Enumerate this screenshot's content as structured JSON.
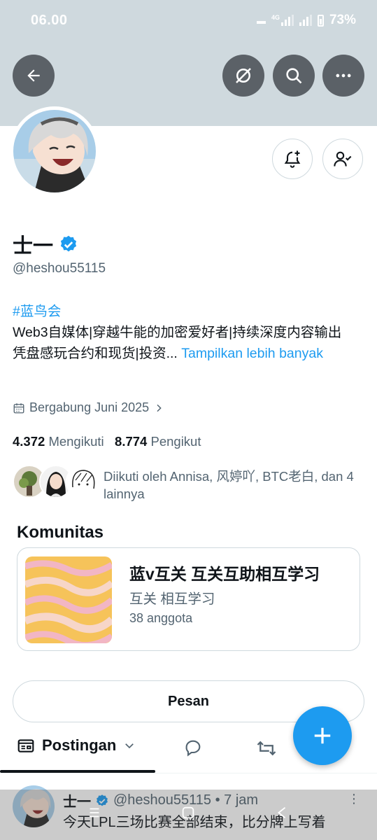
{
  "status_bar": {
    "time": "06.00",
    "network": "4G",
    "battery": "73%"
  },
  "header": {
    "icons": [
      "back-arrow-icon",
      "grok-icon",
      "search-icon",
      "more-icon"
    ]
  },
  "profile": {
    "name": "士一",
    "handle": "@heshou55115",
    "bio_hashtag": "#蓝鸟会",
    "bio_line1": "Web3自媒体|穿越牛能的加密爱好者|持续深度内容输出",
    "bio_line2": "凭盘感玩合约和现货|投资...",
    "show_more": "Tampilkan lebih banyak",
    "joined": "Bergabung Juni 2025",
    "following_count": "4.372",
    "following_label": "Mengikuti",
    "followers_count": "8.774",
    "followers_label": "Pengikut",
    "followed_by": "Diikuti oleh Annisa, 风婷吖, BTC老白, dan 4 lainnya"
  },
  "community": {
    "section_title": "Komunitas",
    "name": "蓝v互关 互关互助相互学习",
    "tags": "互关 相互学习",
    "members": "38 anggota"
  },
  "actions": {
    "message": "Pesan"
  },
  "tabs": {
    "active": "Postingan"
  },
  "post": {
    "name": "士一",
    "handle_time": "@heshou55115 • 7 jam",
    "text": "今天LPL三场比赛全部结束，比分牌上写着"
  },
  "colors": {
    "accent": "#1d9bf0",
    "banner": "#cfd9de",
    "text": "#0f1419",
    "secondary_text": "#536471"
  }
}
